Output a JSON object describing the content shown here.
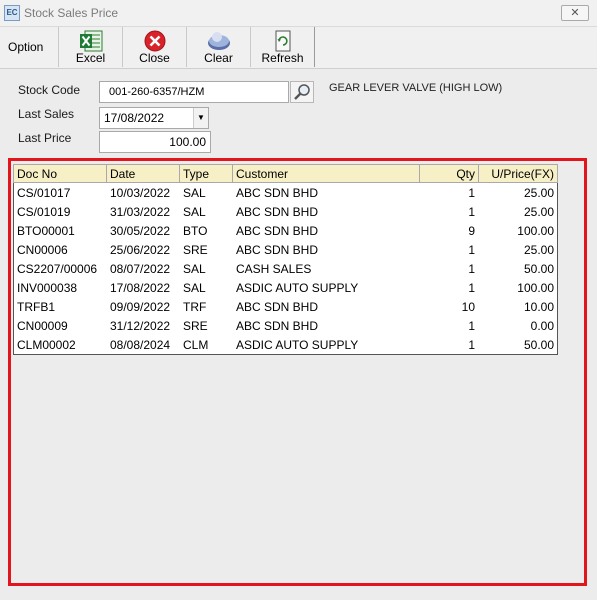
{
  "window": {
    "title": "Stock Sales Price",
    "app_icon_text": "EC",
    "close_label": "✕"
  },
  "toolbar": {
    "option_label": "Option",
    "buttons": [
      {
        "label": "Excel",
        "icon": "excel-icon"
      },
      {
        "label": "Close",
        "icon": "close-circle-icon"
      },
      {
        "label": "Clear",
        "icon": "clear-icon"
      },
      {
        "label": "Refresh",
        "icon": "refresh-icon"
      }
    ]
  },
  "form": {
    "stock_code_label": "Stock Code",
    "stock_code_value": "001-260-6357/HZM",
    "stock_description": "GEAR LEVER VALVE (HIGH LOW)",
    "last_sales_label": "Last Sales",
    "last_sales_value": "17/08/2022",
    "last_price_label": "Last Price",
    "last_price_value": "100.00"
  },
  "grid": {
    "columns": [
      "Doc No",
      "Date",
      "Type",
      "Customer",
      "Qty",
      "U/Price(FX)"
    ],
    "rows": [
      [
        "CS/01017",
        "10/03/2022",
        "SAL",
        "ABC SDN BHD",
        "1",
        "25.00"
      ],
      [
        "CS/01019",
        "31/03/2022",
        "SAL",
        "ABC SDN BHD",
        "1",
        "25.00"
      ],
      [
        "BTO00001",
        "30/05/2022",
        "BTO",
        "ABC SDN BHD",
        "9",
        "100.00"
      ],
      [
        "CN00006",
        "25/06/2022",
        "SRE",
        "ABC SDN BHD",
        "1",
        "25.00"
      ],
      [
        "CS2207/00006",
        "08/07/2022",
        "SAL",
        "CASH SALES",
        "1",
        "50.00"
      ],
      [
        "INV000038",
        "17/08/2022",
        "SAL",
        "ASDIC AUTO SUPPLY",
        "1",
        "100.00"
      ],
      [
        "TRFB1",
        "09/09/2022",
        "TRF",
        "ABC SDN BHD",
        "10",
        "10.00"
      ],
      [
        "CN00009",
        "31/12/2022",
        "SRE",
        "ABC SDN BHD",
        "1",
        "0.00"
      ],
      [
        "CLM00002",
        "08/08/2024",
        "CLM",
        "ASDIC AUTO SUPPLY",
        "1",
        "50.00"
      ]
    ]
  },
  "colors": {
    "highlight_border": "#e1151b",
    "header_bg": "#f7f0c6"
  }
}
